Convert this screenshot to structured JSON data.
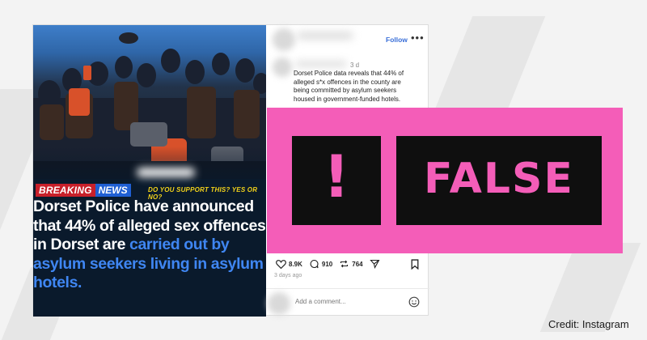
{
  "post": {
    "follow_label": "Follow",
    "more_label": "•••",
    "time_ago": "3 d",
    "caption": "Dorset Police data reveals that 44% of alleged s*x offences in the county are being committed by asylum seekers housed in government-funded hotels.",
    "likes": "8.9K",
    "comments": "910",
    "reposts": "764",
    "date": "3 days ago",
    "comment_placeholder": "Add a comment..."
  },
  "image_overlay": {
    "breaking": "BREAKING",
    "news": "NEWS",
    "question": "DO YOU SUPPORT THIS? YES OR NO?",
    "headline_white": "Dorset Police have announced that 44% of alleged sex offences in Dorset are ",
    "headline_blue": "carried out by asylum seekers living in asylum hotels."
  },
  "verdict": {
    "exclamation": "!",
    "label": "FALSE",
    "color_bg": "#f45db8",
    "color_box": "#0f0f0f"
  },
  "credit": "Credit: Instagram",
  "icons": [
    "heart-icon",
    "comment-icon",
    "repost-icon",
    "share-icon",
    "bookmark-icon",
    "emoji-icon",
    "more-icon"
  ]
}
